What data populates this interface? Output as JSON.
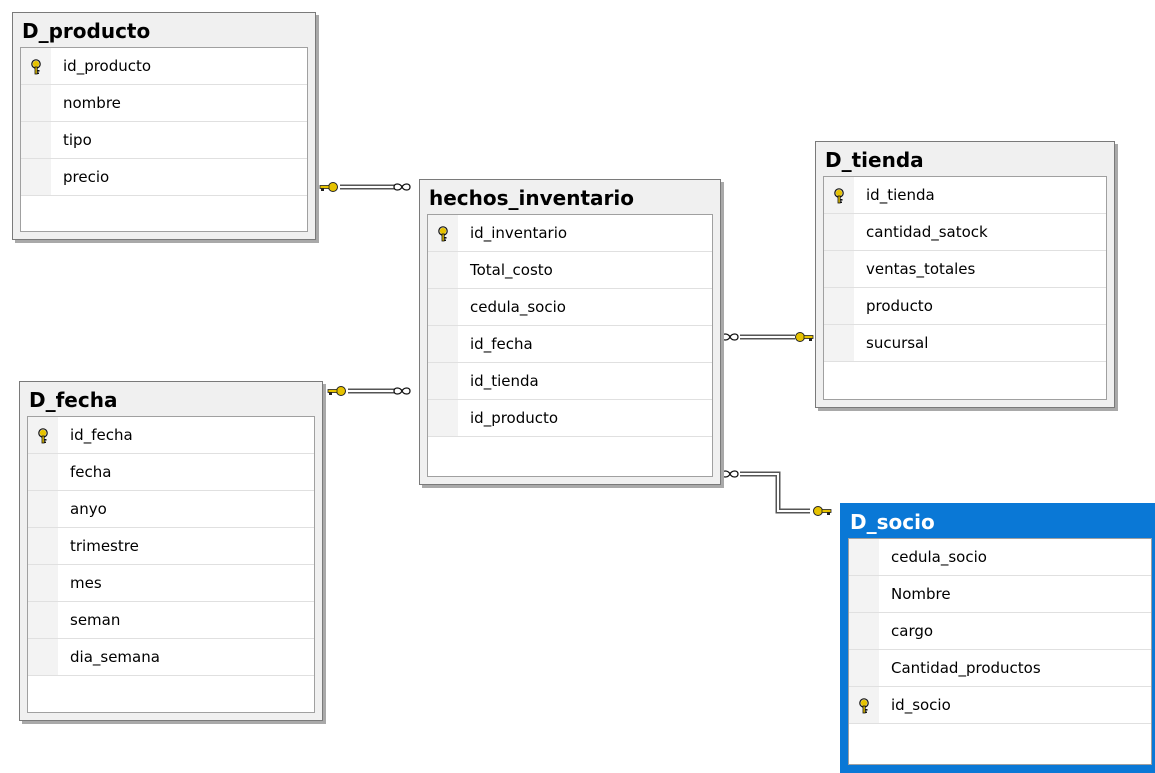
{
  "tables": {
    "producto": {
      "title": "D_producto",
      "columns": [
        {
          "name": "id_producto",
          "is_key": true
        },
        {
          "name": "nombre",
          "is_key": false
        },
        {
          "name": "tipo",
          "is_key": false
        },
        {
          "name": "precio",
          "is_key": false
        }
      ]
    },
    "fecha": {
      "title": "D_fecha",
      "columns": [
        {
          "name": "id_fecha",
          "is_key": true
        },
        {
          "name": "fecha",
          "is_key": false
        },
        {
          "name": "anyo",
          "is_key": false
        },
        {
          "name": "trimestre",
          "is_key": false
        },
        {
          "name": "mes",
          "is_key": false
        },
        {
          "name": "seman",
          "is_key": false
        },
        {
          "name": "dia_semana",
          "is_key": false
        }
      ]
    },
    "hechos": {
      "title": "hechos_inventario",
      "columns": [
        {
          "name": "id_inventario",
          "is_key": true
        },
        {
          "name": "Total_costo",
          "is_key": false
        },
        {
          "name": "cedula_socio",
          "is_key": false
        },
        {
          "name": "id_fecha",
          "is_key": false
        },
        {
          "name": "id_tienda",
          "is_key": false
        },
        {
          "name": "id_producto",
          "is_key": false
        }
      ]
    },
    "tienda": {
      "title": "D_tienda",
      "columns": [
        {
          "name": "id_tienda",
          "is_key": true
        },
        {
          "name": "cantidad_satock",
          "is_key": false
        },
        {
          "name": "ventas_totales",
          "is_key": false
        },
        {
          "name": "producto",
          "is_key": false
        },
        {
          "name": "sucursal",
          "is_key": false
        }
      ]
    },
    "socio": {
      "title": "D_socio",
      "selected": true,
      "columns": [
        {
          "name": "cedula_socio",
          "is_key": false
        },
        {
          "name": "Nombre",
          "is_key": false
        },
        {
          "name": "cargo",
          "is_key": false
        },
        {
          "name": "Cantidad_productos",
          "is_key": false
        },
        {
          "name": "id_socio",
          "is_key": true
        }
      ]
    }
  },
  "relationships": [
    {
      "from": "hechos",
      "to": "producto"
    },
    {
      "from": "hechos",
      "to": "fecha"
    },
    {
      "from": "hechos",
      "to": "tienda"
    },
    {
      "from": "hechos",
      "to": "socio"
    }
  ],
  "colors": {
    "key_icon": "#e6c200",
    "selected_header": "#0a78d6",
    "connector": "#555555"
  },
  "icons": {
    "primary_key": "key-icon",
    "many_end": "infinity-icon",
    "one_end": "key-icon"
  }
}
